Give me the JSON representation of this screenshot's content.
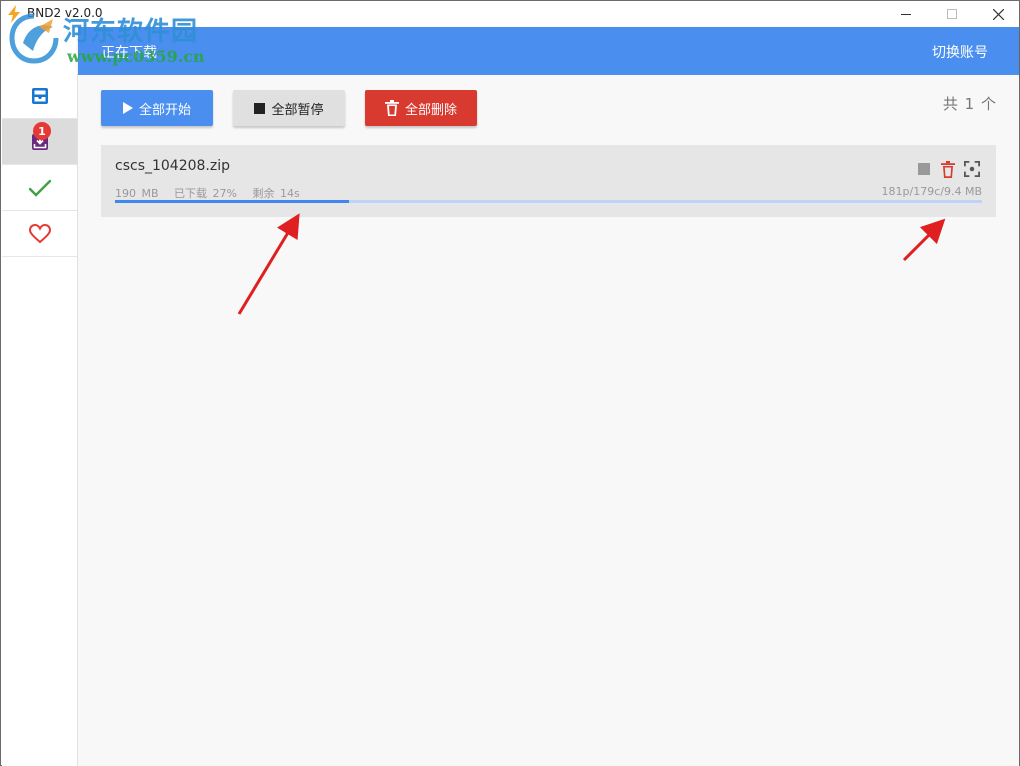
{
  "window": {
    "title": "BND2 v2.0.0"
  },
  "watermark": {
    "name": "河东软件园",
    "url": "www.pc0359.cn"
  },
  "header": {
    "title": "正在下载",
    "account_label": "切换账号"
  },
  "sidebar": {
    "items": [
      {
        "icon": "inbox-icon",
        "active": false
      },
      {
        "icon": "download-icon",
        "active": true,
        "badge": "1"
      },
      {
        "icon": "check-icon",
        "active": false
      },
      {
        "icon": "heart-icon",
        "active": false
      }
    ]
  },
  "toolbar": {
    "start_all": "全部开始",
    "pause_all": "全部暂停",
    "delete_all": "全部删除",
    "total": "共 1 个"
  },
  "tasks": [
    {
      "name": "cscs_104208.zip",
      "size": "190 MB",
      "downloaded": "已下载 27%",
      "remaining": "剩余 14s",
      "stats": "181p/179c/9.4 MB",
      "progress": 0.27
    }
  ],
  "colors": {
    "accent": "#4a8ff0",
    "danger": "#d93a30",
    "progress": "#3f86ee"
  }
}
